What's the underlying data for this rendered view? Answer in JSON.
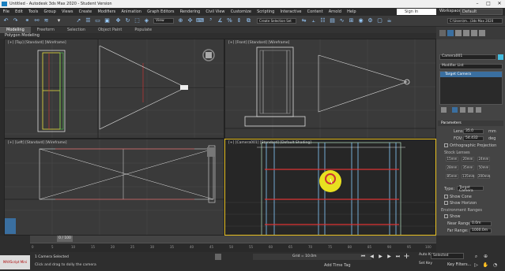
{
  "window": {
    "title": "Untitled - Autodesk 3ds Max 2020 - Student Version",
    "minimize": "–",
    "maximize": "□",
    "close": "✕"
  },
  "menu": [
    "File",
    "Edit",
    "Tools",
    "Group",
    "Views",
    "Create",
    "Modifiers",
    "Animation",
    "Graph Editors",
    "Rendering",
    "Civil View",
    "Customize",
    "Scripting",
    "Interactive",
    "Content",
    "Arnold",
    "Help"
  ],
  "signin": "Sign In",
  "workspace": {
    "label": "Workspaces:",
    "value": "Default"
  },
  "toolbar": {
    "view_select": "View",
    "selection_set": "Create Selection Set",
    "path": "C:\\Users\\m...\\3ds Max 2020"
  },
  "ribbon": {
    "tabs": [
      "Modeling",
      "Freeform",
      "Selection",
      "Object Paint",
      "Populate"
    ],
    "active": 0,
    "sub": "Polygon Modeling"
  },
  "viewports": {
    "top": "[+] [Top] [Standard] [Wireframe]",
    "front": "[+] [Front] [Standard] [Wireframe]",
    "left": "[+] [Left] [Standard] [Wireframe]",
    "camera": "[+] [Camera001] [Standard] [Default Shading]"
  },
  "cmd": {
    "object_name": "Camera001",
    "modifier_list": "Modifier List",
    "stack_item": "Target Camera",
    "params_header": "Parameters",
    "lens_label": "Lens:",
    "lens_value": "35.0",
    "lens_unit": "mm",
    "fov_label": "FOV:",
    "fov_value": "54.432",
    "fov_unit": "deg",
    "ortho": "Orthographic Projection",
    "stock_lenses": "Stock Lenses",
    "lenses": [
      "15mm",
      "20mm",
      "24mm",
      "28mm",
      "35mm",
      "50mm",
      "85mm",
      "135mm",
      "200mm"
    ],
    "type_label": "Type:",
    "type_value": "Target Camera",
    "show_cone": "Show Cone",
    "show_horizon": "Show Horizon",
    "env_ranges": "Environment Ranges",
    "show": "Show",
    "near_label": "Near Range:",
    "near_value": "0.0m",
    "far_label": "Far Range:",
    "far_value": "1000.0m"
  },
  "timeline": {
    "frame": "0 / 100",
    "ticks": [
      "0",
      "5",
      "10",
      "15",
      "20",
      "25",
      "30",
      "35",
      "40",
      "45",
      "50",
      "55",
      "60",
      "65",
      "70",
      "75",
      "80",
      "85",
      "90",
      "95",
      "100"
    ]
  },
  "status": {
    "selected": "1 Camera Selected",
    "prompt": "Click and drag to dolly the camera",
    "grid": "Grid = 10.0m",
    "add_time_tag": "Add Time Tag",
    "auto_key": "Auto Key",
    "set_key": "Set Key",
    "selected_dd": "Selected",
    "filters": "Key Filters...",
    "logo_text": "MAXScript Mini"
  }
}
